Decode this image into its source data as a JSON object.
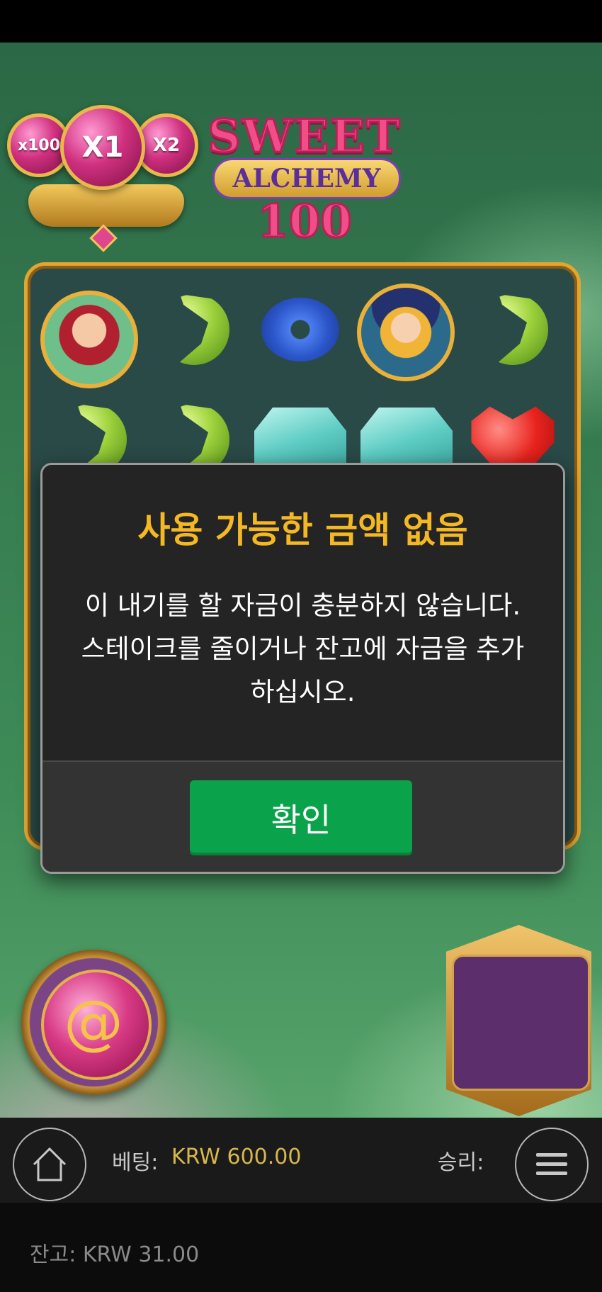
{
  "game": {
    "logo_line1": "SWEET",
    "logo_line2": "ALCHEMY",
    "logo_line3": "100",
    "multipliers": [
      "x100",
      "X1",
      "X2"
    ]
  },
  "reels": {
    "row1": [
      "green-haired-witch-avatar",
      "green-bean",
      "blue-donut",
      "blonde-witch-avatar",
      "green-bean"
    ],
    "row2": [
      "green-bean",
      "green-bean",
      "teal-cube",
      "teal-cube",
      "red-heart"
    ]
  },
  "dialog": {
    "title": "사용 가능한 금액 없음",
    "message": "이 내기를 할 자금이 충분하지 않습니다. 스테이크를 줄이거나 잔고에 자금을 추가하십시오.",
    "ok_label": "확인"
  },
  "bottom_bar": {
    "bet_label": "베팅:",
    "bet_value": "KRW 600.00",
    "win_label": "승리:",
    "home_icon": "home-icon",
    "menu_icon": "hamburger-menu-icon"
  },
  "balance": {
    "text": "잔고: KRW 31.00"
  },
  "colors": {
    "title": "#f3b823",
    "ok_button": "#0aa24a",
    "bet_value": "#d6b74e"
  }
}
